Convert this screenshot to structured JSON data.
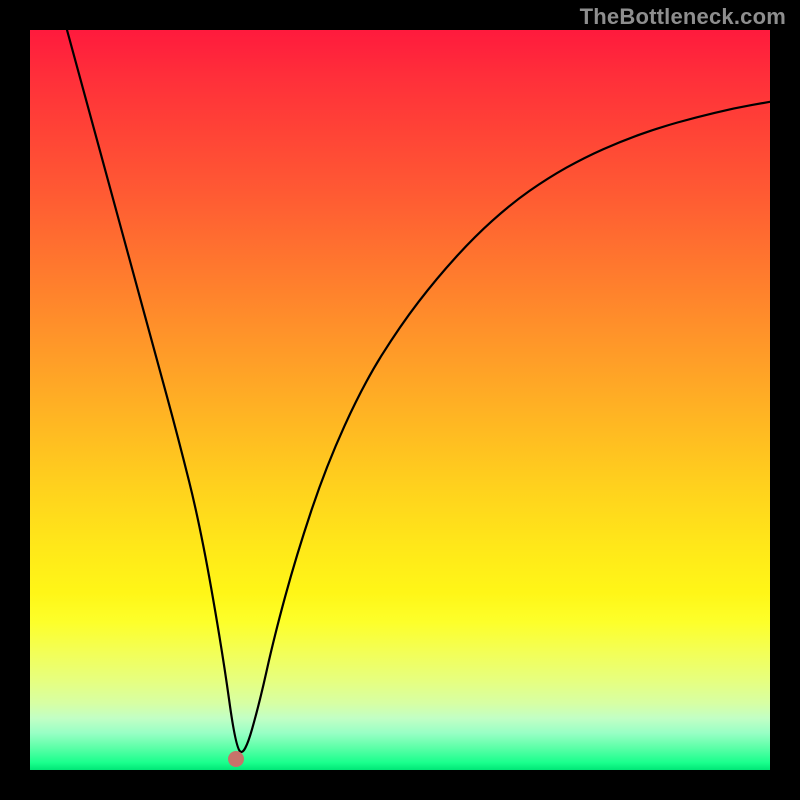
{
  "watermark": "TheBottleneck.com",
  "chart_data": {
    "type": "line",
    "title": "",
    "xlabel": "",
    "ylabel": "",
    "xlim": [
      0,
      100
    ],
    "ylim": [
      0,
      100
    ],
    "grid": false,
    "background": "rainbow-vertical-gradient",
    "series": [
      {
        "name": "curve",
        "x": [
          5,
          8,
          11,
          14,
          17,
          20,
          23,
          26,
          27.8,
          29,
          31,
          33,
          36,
          40,
          45,
          50,
          55,
          60,
          65,
          70,
          75,
          80,
          85,
          90,
          95,
          100
        ],
        "y": [
          100,
          89,
          78,
          67,
          56,
          45,
          33,
          16,
          3,
          2,
          9,
          18,
          29,
          41,
          52,
          60,
          66.5,
          72,
          76.5,
          80,
          82.8,
          85,
          86.8,
          88.2,
          89.4,
          90.3
        ]
      }
    ],
    "marker": {
      "x": 27.8,
      "y": 1.5
    },
    "colors": {
      "curve": "#000000",
      "marker": "#c7736a",
      "frame": "#000000"
    }
  }
}
